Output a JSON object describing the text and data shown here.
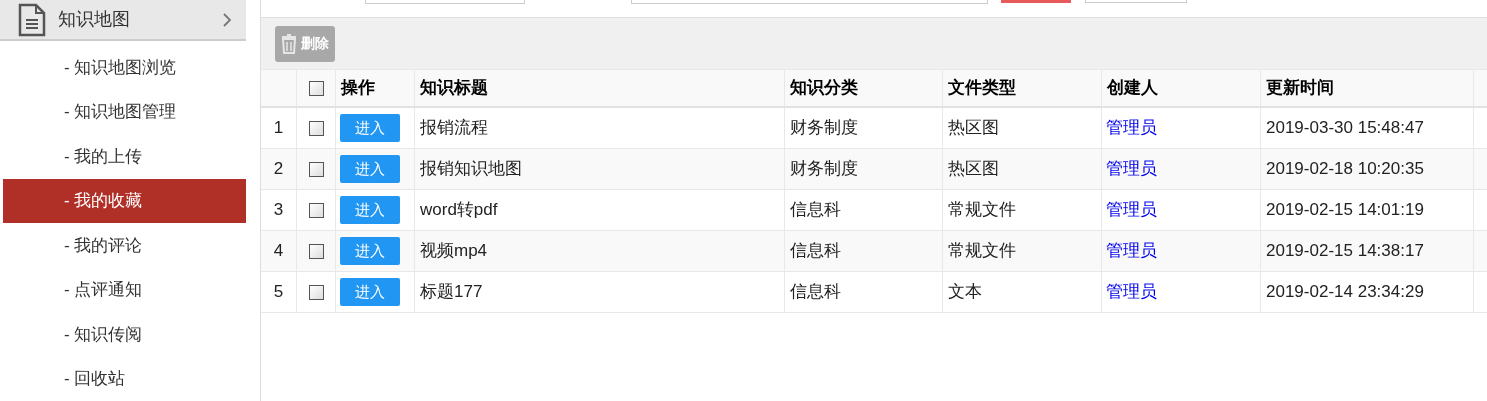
{
  "sidebar": {
    "title": "知识地图",
    "items": [
      {
        "label": "- 知识地图浏览",
        "selected": false
      },
      {
        "label": "- 知识地图管理",
        "selected": false
      },
      {
        "label": "- 我的上传",
        "selected": false
      },
      {
        "label": "- 我的收藏",
        "selected": true
      },
      {
        "label": "- 我的评论",
        "selected": false
      },
      {
        "label": "- 点评通知",
        "selected": false
      },
      {
        "label": "- 知识传阅",
        "selected": false
      },
      {
        "label": "- 回收站",
        "selected": false
      }
    ]
  },
  "toolbar": {
    "delete_button": "删除"
  },
  "table": {
    "select_all_checked": false,
    "columns": [
      "操作",
      "知识标题",
      "知识分类",
      "文件类型",
      "创建人",
      "更新时间"
    ],
    "rows": [
      {
        "index": "1",
        "checked": false,
        "action": "进入",
        "title": "报销流程",
        "category": "财务制度",
        "file_type": "热区图",
        "creator": "管理员",
        "updated": "2019-03-30 15:48:47"
      },
      {
        "index": "2",
        "checked": false,
        "action": "进入",
        "title": "报销知识地图",
        "category": "财务制度",
        "file_type": "热区图",
        "creator": "管理员",
        "updated": "2019-02-18 10:20:35"
      },
      {
        "index": "3",
        "checked": false,
        "action": "进入",
        "title": "word转pdf",
        "category": "信息科",
        "file_type": "常规文件",
        "creator": "管理员",
        "updated": "2019-02-15 14:01:19"
      },
      {
        "index": "4",
        "checked": false,
        "action": "进入",
        "title": "视频mp4",
        "category": "信息科",
        "file_type": "常规文件",
        "creator": "管理员",
        "updated": "2019-02-15 14:38:17"
      },
      {
        "index": "5",
        "checked": false,
        "action": "进入",
        "title": "标题177",
        "category": "信息科",
        "file_type": "文本",
        "creator": "管理员",
        "updated": "2019-02-14 23:34:29"
      }
    ]
  }
}
